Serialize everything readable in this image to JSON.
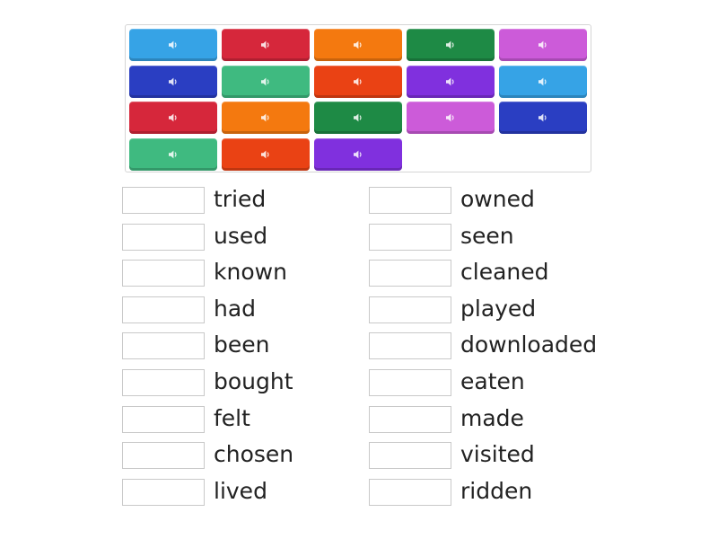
{
  "tiles": [
    {
      "color": "#36a3e6",
      "icon": "speaker-icon"
    },
    {
      "color": "#d6273b",
      "icon": "speaker-icon"
    },
    {
      "color": "#f4790f",
      "icon": "speaker-icon"
    },
    {
      "color": "#1e8a45",
      "icon": "speaker-icon"
    },
    {
      "color": "#cc5bd9",
      "icon": "speaker-icon"
    },
    {
      "color": "#2a3ec2",
      "icon": "speaker-icon"
    },
    {
      "color": "#3fba80",
      "icon": "speaker-icon"
    },
    {
      "color": "#ea4214",
      "icon": "speaker-icon"
    },
    {
      "color": "#8030de",
      "icon": "speaker-icon"
    },
    {
      "color": "#36a3e6",
      "icon": "speaker-icon"
    },
    {
      "color": "#d6273b",
      "icon": "speaker-icon"
    },
    {
      "color": "#f4790f",
      "icon": "speaker-icon"
    },
    {
      "color": "#1e8a45",
      "icon": "speaker-icon"
    },
    {
      "color": "#cc5bd9",
      "icon": "speaker-icon"
    },
    {
      "color": "#2a3ec2",
      "icon": "speaker-icon"
    },
    {
      "color": "#3fba80",
      "icon": "speaker-icon"
    },
    {
      "color": "#ea4214",
      "icon": "speaker-icon"
    },
    {
      "color": "#8030de",
      "icon": "speaker-icon"
    }
  ],
  "left_words": [
    "tried",
    "used",
    "known",
    "had",
    "been",
    "bought",
    "felt",
    "chosen",
    "lived"
  ],
  "right_words": [
    "owned",
    "seen",
    "cleaned",
    "played",
    "downloaded",
    "eaten",
    "made",
    "visited",
    "ridden"
  ]
}
